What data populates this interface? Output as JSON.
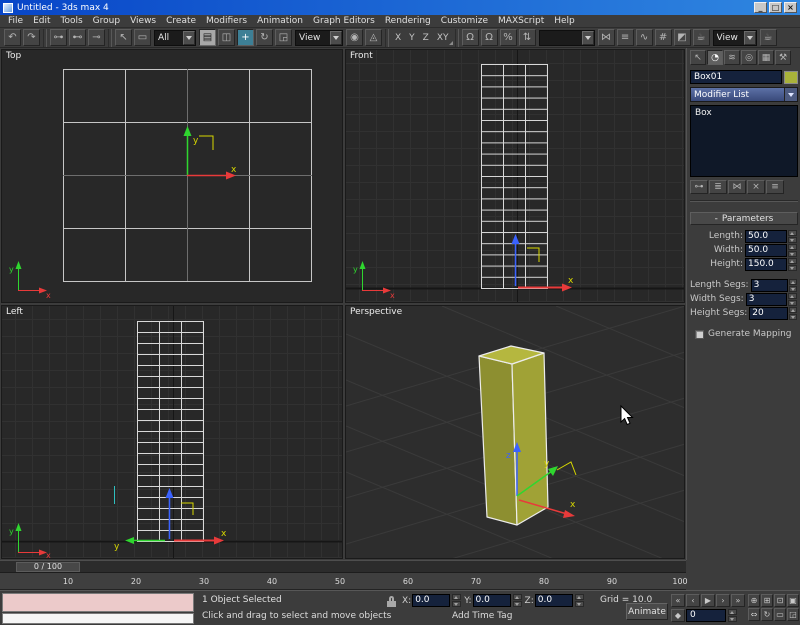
{
  "titlebar": {
    "title": "Untitled - 3ds max 4",
    "buttons": [
      {
        "name": "minimize-button",
        "glyph": "_"
      },
      {
        "name": "maximize-button",
        "glyph": "□"
      },
      {
        "name": "close-button",
        "glyph": "×"
      }
    ]
  },
  "menubar": {
    "items": [
      {
        "name": "menu-file",
        "label": "File"
      },
      {
        "name": "menu-edit",
        "label": "Edit"
      },
      {
        "name": "menu-tools",
        "label": "Tools"
      },
      {
        "name": "menu-group",
        "label": "Group"
      },
      {
        "name": "menu-views",
        "label": "Views"
      },
      {
        "name": "menu-create",
        "label": "Create"
      },
      {
        "name": "menu-modifiers",
        "label": "Modifiers"
      },
      {
        "name": "menu-animation",
        "label": "Animation"
      },
      {
        "name": "menu-graph-editors",
        "label": "Graph Editors"
      },
      {
        "name": "menu-rendering",
        "label": "Rendering"
      },
      {
        "name": "menu-customize",
        "label": "Customize"
      },
      {
        "name": "menu-maxscript",
        "label": "MAXScript"
      },
      {
        "name": "menu-help",
        "label": "Help"
      }
    ]
  },
  "toolbar": {
    "items": [
      {
        "name": "undo-icon",
        "glyph": "↶",
        "cls": "tbtn",
        "inter": "true"
      },
      {
        "name": "redo-icon",
        "glyph": "↷",
        "cls": "tbtn",
        "inter": "true"
      },
      {
        "name": "toolbar-separator",
        "cls": "tsep",
        "inter": "false"
      },
      {
        "name": "select-and-link-icon",
        "glyph": "⊶",
        "cls": "tbtn",
        "inter": "true"
      },
      {
        "name": "unlink-selection-icon",
        "glyph": "⊷",
        "cls": "tbtn",
        "inter": "true"
      },
      {
        "name": "bind-to-spacewarp-icon",
        "glyph": "⊸",
        "cls": "tbtn",
        "inter": "true"
      },
      {
        "name": "toolbar-separator",
        "cls": "tsep",
        "inter": "false"
      },
      {
        "name": "select-object-icon",
        "glyph": "↖",
        "cls": "tbtn",
        "inter": "true"
      },
      {
        "name": "rect-selection-region-icon",
        "glyph": "▭",
        "cls": "tbtn",
        "inter": "true"
      },
      {
        "name": "selection-filter-combo",
        "label": "All",
        "cls": "tcombo",
        "style": "width:42px",
        "inter": "true"
      },
      {
        "name": "select-by-name-icon",
        "glyph": "▤",
        "cls": "tbtn tpressed",
        "inter": "true"
      },
      {
        "name": "window-crossing-toggle-icon",
        "glyph": "◫",
        "cls": "tbtn",
        "inter": "true"
      },
      {
        "name": "select-and-move-icon",
        "glyph": "+",
        "cls": "tbtn tactive",
        "inter": "true"
      },
      {
        "name": "select-and-rotate-icon",
        "glyph": "↻",
        "cls": "tbtn",
        "inter": "true"
      },
      {
        "name": "select-and-scale-icon",
        "glyph": "◲",
        "cls": "tbtn",
        "inter": "true"
      },
      {
        "name": "reference-coordsys-combo",
        "label": "View",
        "cls": "tcombo",
        "style": "width:48px",
        "inter": "true"
      },
      {
        "name": "use-pivot-center-icon",
        "glyph": "◉",
        "cls": "tbtn",
        "inter": "true"
      },
      {
        "name": "select-and-manipulate-icon",
        "glyph": "◬",
        "cls": "tbtn",
        "inter": "true"
      },
      {
        "name": "toolbar-separator",
        "cls": "tsep",
        "inter": "false"
      },
      {
        "name": "restrict-x-button",
        "label": "X",
        "cls": "tflat",
        "inter": "true"
      },
      {
        "name": "restrict-y-button",
        "label": "Y",
        "cls": "tflat",
        "inter": "true"
      },
      {
        "name": "restrict-z-button",
        "label": "Z",
        "cls": "tflat",
        "inter": "true"
      },
      {
        "name": "restrict-xy-plane-button",
        "label": "XY",
        "cls": "tflat tcorner",
        "in ter": "true",
        "inter": "true"
      },
      {
        "name": "toolbar-separator",
        "cls": "tsep",
        "inter": "false"
      },
      {
        "name": "snap-toggle-icon",
        "glyph": "Ω",
        "cls": "tbtn",
        "inter": "true"
      },
      {
        "name": "angle-snap-icon",
        "glyph": "Ω",
        "cls": "tbtn",
        "inter": "true"
      },
      {
        "name": "percent-snap-icon",
        "glyph": "%",
        "cls": "tbtn",
        "inter": "true"
      },
      {
        "name": "spinner-snap-icon",
        "glyph": "⇅",
        "cls": "tbtn",
        "inter": "true"
      },
      {
        "name": "named-selection-sets-combo",
        "label": "",
        "cls": "tcombo",
        "style": "width:56px",
        "inter": "true"
      },
      {
        "name": "mirror-icon",
        "glyph": "⋈",
        "cls": "tbtn",
        "inter": "true"
      },
      {
        "name": "align-icon",
        "glyph": "≡",
        "cls": "tbtn",
        "inter": "true"
      },
      {
        "name": "track-view-icon",
        "glyph": "∿",
        "cls": "tbtn",
        "inter": "true"
      },
      {
        "name": "schematic-view-icon",
        "glyph": "#",
        "cls": "tbtn",
        "inter": "true"
      },
      {
        "name": "material-editor-icon",
        "glyph": "◩",
        "cls": "tbtn",
        "inter": "true"
      },
      {
        "name": "render-scene-icon",
        "glyph": "☕",
        "cls": "tbtn",
        "inter": "true"
      },
      {
        "name": "render-type-combo",
        "label": "View",
        "cls": "tcombo",
        "style": "width:44px",
        "inter": "true"
      },
      {
        "name": "quick-render-icon",
        "glyph": "☕",
        "cls": "tbtn",
        "inter": "true"
      }
    ]
  },
  "viewports": {
    "top": {
      "label": "Top"
    },
    "front": {
      "label": "Front"
    },
    "left": {
      "label": "Left"
    },
    "perspective": {
      "label": "Perspective"
    },
    "axis_labels": {
      "x": "x",
      "y": "y",
      "z": "z"
    }
  },
  "command_panel": {
    "tabs": [
      {
        "name": "create-tab",
        "glyph": "↖",
        "cls": "",
        "inter": "true"
      },
      {
        "name": "modify-tab",
        "glyph": "◔",
        "cls": "active",
        "inter": "true"
      },
      {
        "name": "hierarchy-tab",
        "glyph": "≋",
        "cls": "",
        "inter": "true"
      },
      {
        "name": "motion-tab",
        "glyph": "◎",
        "cls": "",
        "inter": "true"
      },
      {
        "name": "display-tab",
        "glyph": "▦",
        "cls": "",
        "inter": "true"
      },
      {
        "name": "utilities-tab",
        "glyph": "⚒",
        "cls": "",
        "inter": "true"
      }
    ],
    "object_name": "Box01",
    "object_color": "#a9b23a",
    "modifier_list_label": "Modifier List",
    "stack": [
      "Box"
    ],
    "stack_buttons": [
      {
        "name": "pin-stack-icon",
        "glyph": "⊶"
      },
      {
        "name": "show-end-result-icon",
        "glyph": "≣"
      },
      {
        "name": "make-unique-icon",
        "glyph": "⋈"
      },
      {
        "name": "remove-modifier-icon",
        "glyph": "×"
      },
      {
        "name": "configure-button-sets-icon",
        "glyph": "≡"
      }
    ],
    "rollout": {
      "collapse": "-",
      "title": "Parameters"
    },
    "parameters": [
      {
        "name": "length-field",
        "label": "Length:",
        "value": "50.0",
        "cls": ""
      },
      {
        "name": "width-field",
        "label": "Width:",
        "value": "50.0",
        "cls": ""
      },
      {
        "name": "height-field",
        "label": "Height:",
        "value": "150.0",
        "cls": ""
      },
      {
        "name": "length-segs-field",
        "label": "Length Segs:",
        "value": "3",
        "cls": "gap"
      },
      {
        "name": "width-segs-field",
        "label": "Width Segs:",
        "value": "3",
        "cls": ""
      },
      {
        "name": "height-segs-field",
        "label": "Height Segs:",
        "value": "20",
        "cls": ""
      }
    ],
    "generate_mapping_label": "Generate Mapping"
  },
  "trackbar": {
    "frame_indicator": "0 / 100"
  },
  "timeruler": {
    "ticks": [
      {
        "label": "10"
      },
      {
        "label": "20"
      },
      {
        "label": "30"
      },
      {
        "label": "40"
      },
      {
        "label": "50"
      },
      {
        "label": "60"
      },
      {
        "label": "70"
      },
      {
        "label": "80"
      },
      {
        "label": "90"
      },
      {
        "label": "100"
      }
    ]
  },
  "statusbar": {
    "selection_status": "1 Object Selected",
    "prompt": "Click and drag to select and move objects",
    "add_time_tag": "Add Time Tag",
    "grid_readout": "Grid = 10.0",
    "coords": [
      {
        "name": "x-coordinate-field",
        "label": "X:",
        "value": "0.0"
      },
      {
        "name": "y-coordinate-field",
        "label": "Y:",
        "value": "0.0"
      },
      {
        "name": "z-coordinate-field",
        "label": "Z:",
        "value": "0.0"
      }
    ],
    "animate_label": "Animate",
    "key_mode_glyph": "◆",
    "time_field_value": "0",
    "playback": [
      {
        "name": "go-to-start-button",
        "glyph": "«"
      },
      {
        "name": "previous-frame-button",
        "glyph": "‹"
      },
      {
        "name": "play-button",
        "glyph": "▶"
      },
      {
        "name": "next-frame-button",
        "glyph": "›"
      },
      {
        "name": "go-to-end-button",
        "glyph": "»"
      }
    ],
    "nav_buttons": [
      {
        "name": "zoom-icon",
        "glyph": "⊕"
      },
      {
        "name": "zoom-all-icon",
        "glyph": "⊞"
      },
      {
        "name": "zoom-extents-icon",
        "glyph": "⊡"
      },
      {
        "name": "zoom-extents-all-icon",
        "glyph": "▣"
      },
      {
        "name": "pan-icon",
        "glyph": "⇔"
      },
      {
        "name": "arc-rotate-icon",
        "glyph": "↻"
      },
      {
        "name": "region-zoom-icon",
        "glyph": "▭"
      },
      {
        "name": "min-max-toggle-icon",
        "glyph": "◲"
      }
    ]
  },
  "colors": {
    "object_color": "#a9b23a",
    "axis_x": "#e83a3a",
    "axis_y": "#2fd62f",
    "axis_z": "#3a62ff",
    "gizmo_label_yellow": "#d8d800",
    "active_tool_highlight": "#3d7f95",
    "titlebar_blue": "#0846c8"
  }
}
